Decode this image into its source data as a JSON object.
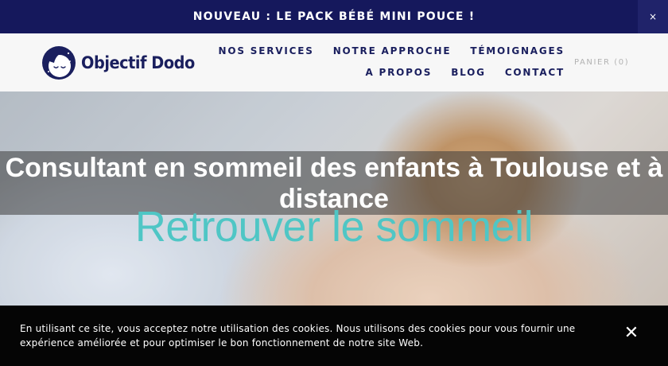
{
  "announcement": {
    "text": "NOUVEAU : LE PACK BÉBÉ MINI POUCE !",
    "close_icon": "×"
  },
  "header": {
    "logo_text": "Objectif Dodo",
    "nav_row1": [
      "NOS SERVICES",
      "NOTRE APPROCHE",
      "TÉMOIGNAGES"
    ],
    "nav_row2": [
      "A PROPOS",
      "BLOG",
      "CONTACT"
    ],
    "cart_label": "PANIER (0)"
  },
  "hero": {
    "title": "Consultant en sommeil des enfants à Toulouse et à distance",
    "subtitle": "Retrouver le sommeil"
  },
  "cookie": {
    "text": "En utilisant ce site, vous acceptez notre utilisation des cookies. Nous utilisons des cookies pour vous fournir une expérience améliorée et pour optimiser le bon fonctionnement de notre site Web.",
    "close_icon": "✕"
  },
  "colors": {
    "announcement_bg": "#15185c",
    "brand_navy": "#1a1f5e",
    "accent_teal": "#4fc6c5",
    "cookie_bg": "#050505"
  },
  "icons": {
    "announcement_close": "close-icon",
    "cookie_close": "close-icon",
    "logo": "sleeping-moon-face-icon"
  }
}
